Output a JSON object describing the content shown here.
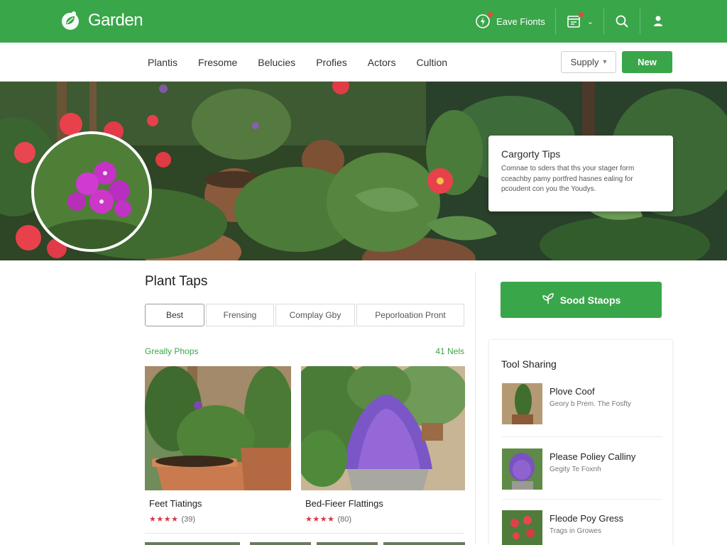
{
  "header": {
    "brand": "Garden",
    "save_label": "Eave Fionts",
    "colors": {
      "primary": "#3aa64a",
      "badge": "#e14a3c"
    },
    "icons": [
      "leaf-logo-icon",
      "lightning-icon",
      "calendar-icon",
      "search-icon",
      "user-icon"
    ]
  },
  "nav": {
    "links": [
      "Plantis",
      "Fresome",
      "Belucies",
      "Profies",
      "Actors",
      "Cultion"
    ],
    "supply_label": "Supply",
    "new_label": "New"
  },
  "hero": {
    "tip_title": "Cargorty Tips",
    "tip_body": "Comnae to sders that ths your stager form cceachby pamy portfred hasnes ealing for pcoudent con you the Youdys."
  },
  "main": {
    "title": "Plant Taps",
    "tabs": [
      "Best",
      "Frensing",
      "Complay Gby",
      "Peporloation Pront"
    ],
    "list_left": "Greally Phops",
    "list_right": "41 Nels",
    "cards": [
      {
        "title": "Feet Tiatings",
        "stars": "★★★★",
        "count": "(39)"
      },
      {
        "title": "Bed-Fieer Flattings",
        "stars": "★★★★",
        "count": "(80)"
      }
    ]
  },
  "sidebar": {
    "cta_label": "Sood Staops",
    "panel_title": "Tool Sharing",
    "items": [
      {
        "name": "Plove Coof",
        "sub": "Geory b Prem. The Fosfty"
      },
      {
        "name": "Please Poliey Calliny",
        "sub": "Gegity Te Foxnh"
      },
      {
        "name": "Fleode Poy Gress",
        "sub": "Trags in Growes"
      }
    ]
  }
}
